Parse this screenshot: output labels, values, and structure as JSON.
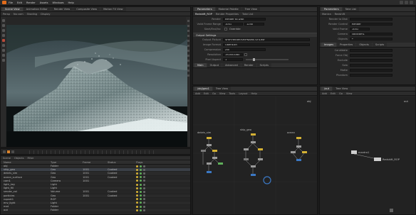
{
  "menubar": {
    "items": [
      "File",
      "Edit",
      "Render",
      "Assets",
      "Windows",
      "Help"
    ]
  },
  "viewport": {
    "tabs": [
      "Scene View",
      "Animation Editor",
      "Render View",
      "Composite View",
      "Motion FX View"
    ],
    "tool_labels": [
      "Persp",
      "No cam",
      "Shading",
      "Display"
    ]
  },
  "params": {
    "tabs": [
      "Parameters",
      "Material Palette",
      "Tree View"
    ],
    "toolbar": [
      "Render Properties",
      "Take List"
    ],
    "node_title": "Redshift_ROP",
    "rows_top": [
      {
        "label": "Render",
        "value": "Render to Disk"
      },
      {
        "label": "Valid Frame Range",
        "value": "1001"
      },
      {
        "label": "Start/End/Inc",
        "value": "1240"
      }
    ],
    "section": "Output Settings",
    "rows_mid": [
      {
        "label": "Output Picture",
        "value": "$HIP/render/$HIPNAME.$F4.exr"
      },
      {
        "label": "Image Format",
        "value": "OpenEXR"
      },
      {
        "label": "Compression",
        "value": "Zip"
      }
    ],
    "rows_bottom": [
      {
        "label": "Resolution",
        "value": "1920x1080"
      },
      {
        "label": "Pixel Aspect",
        "value": "1"
      }
    ],
    "checkbox_label": "Override",
    "subtabs": [
      "Main",
      "Output",
      "Advanced",
      "Render",
      "Scripts"
    ]
  },
  "network": {
    "tabs": [
      "/obj/geo1",
      "Tree View"
    ],
    "toolbar": [
      "Add",
      "Edit",
      "Go",
      "View",
      "Tools",
      "Layout",
      "Help"
    ],
    "path": "obj",
    "groups": [
      {
        "title": "debris_sim"
      },
      {
        "title": "ship_geo"
      },
      {
        "title": "ocean"
      }
    ]
  },
  "right_params": {
    "tabs": [
      "Parameters",
      "Take List"
    ],
    "toolbar": [
      "Mantra",
      "Redshift"
    ],
    "rows": [
      {
        "label": "Render to Disk",
        "value": ""
      },
      {
        "label": "Render Control",
        "value": "Render"
      },
      {
        "label": "Valid Frame",
        "value": "1001"
      },
      {
        "label": "Camera",
        "value": "/obj/cam1"
      },
      {
        "label": "Objects",
        "value": "*"
      }
    ],
    "subtabs": [
      "Images",
      "Properties",
      "Objects",
      "Scripts"
    ],
    "rows2": [
      {
        "label": "Candidate",
        "value": ""
      },
      {
        "label": "Force Obj",
        "value": ""
      },
      {
        "label": "Exclude",
        "value": ""
      },
      {
        "label": "Solo",
        "value": ""
      },
      {
        "label": "Matte",
        "value": ""
      },
      {
        "label": "Phantom",
        "value": ""
      }
    ]
  },
  "right_network": {
    "tabs": [
      "/out",
      "Tree View"
    ],
    "toolbar": [
      "Add",
      "Edit",
      "Go",
      "View"
    ],
    "path": "out",
    "nodes": [
      {
        "label": "mantra1"
      },
      {
        "label": "Redshift_ROP"
      }
    ]
  },
  "tree": {
    "toolbar": [
      "Scene",
      "Objects",
      "Filter"
    ],
    "headers": [
      "Name",
      "Type",
      "Frame",
      "Status",
      "Flags"
    ],
    "rows": [
      {
        "name": "obj",
        "type": "Folder",
        "a": "",
        "b": "",
        "c": "",
        "sel": false
      },
      {
        "name": "ship_geo",
        "type": "Geo",
        "a": "1001",
        "b": "Cooked",
        "c": "",
        "sel": true
      },
      {
        "name": "debris_sim",
        "type": "Geo",
        "a": "1001",
        "b": "Cooked",
        "c": "",
        "sel": false
      },
      {
        "name": "ocean_surface",
        "type": "Geo",
        "a": "1001",
        "b": "Cooked",
        "c": "",
        "sel": false
      },
      {
        "name": "cam1",
        "type": "Camera",
        "a": "1001",
        "b": "",
        "c": "",
        "sel": false
      },
      {
        "name": "light_key",
        "type": "Light",
        "a": "",
        "b": "",
        "c": "",
        "sel": false
      },
      {
        "name": "light_fill",
        "type": "Light",
        "a": "",
        "b": "",
        "c": "",
        "sel": false
      },
      {
        "name": "smoke_vol",
        "type": "Volume",
        "a": "1001",
        "b": "Cooked",
        "c": "",
        "sel": false
      },
      {
        "name": "particles",
        "type": "Geo",
        "a": "1001",
        "b": "Cooked",
        "c": "",
        "sel": false
      },
      {
        "name": "ropnet1",
        "type": "ROP",
        "a": "",
        "b": "",
        "c": "",
        "sel": false
      },
      {
        "name": "env_light",
        "type": "Light",
        "a": "",
        "b": "",
        "c": "",
        "sel": false
      },
      {
        "name": "mat",
        "type": "Folder",
        "a": "",
        "b": "",
        "c": "",
        "sel": false
      },
      {
        "name": "out",
        "type": "Folder",
        "a": "",
        "b": "",
        "c": "",
        "sel": false
      }
    ]
  },
  "colors": {
    "accent": "#e06b1a",
    "selection_blue": "#3b78c4",
    "node_yellow": "#d4b134"
  }
}
